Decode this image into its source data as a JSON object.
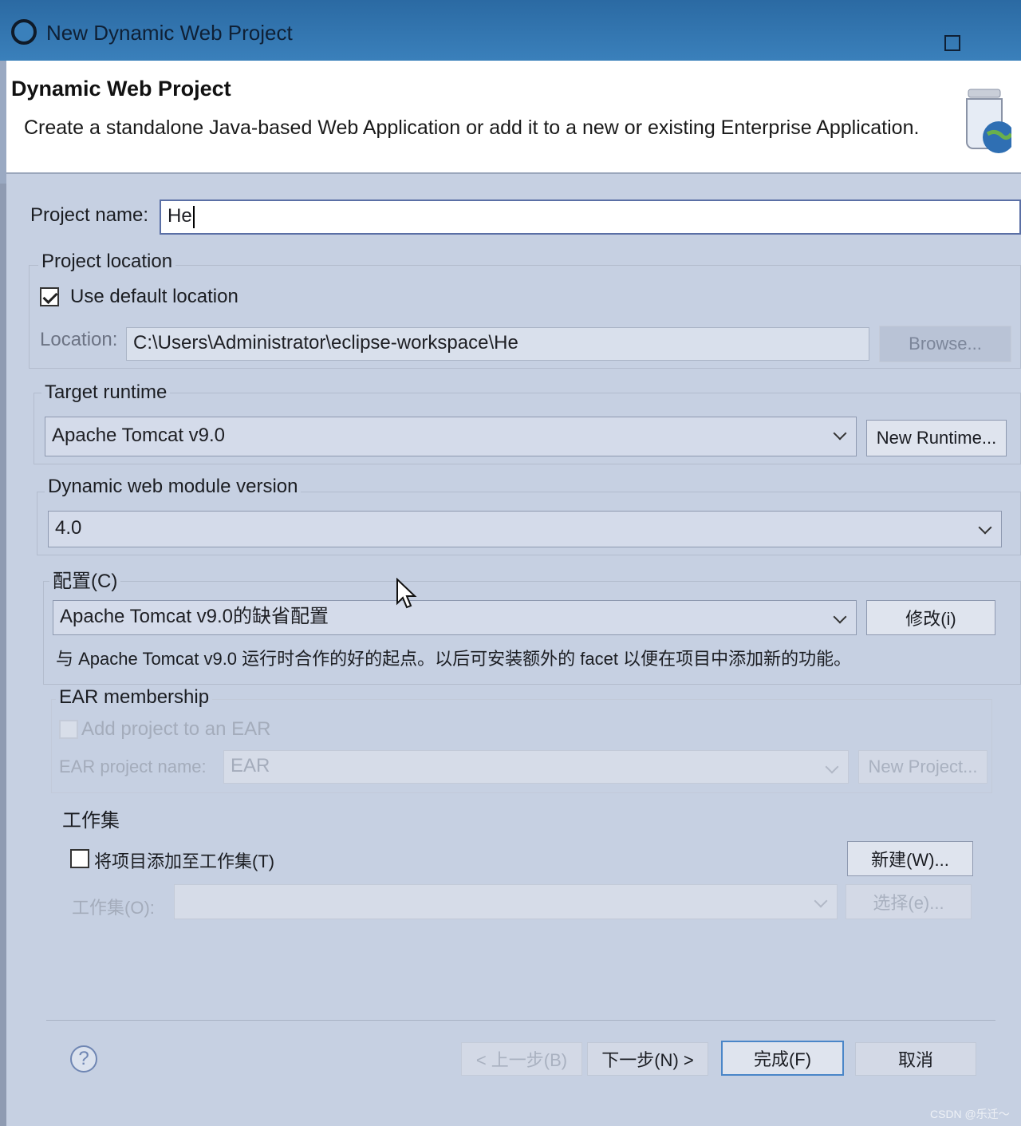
{
  "window": {
    "title": "New Dynamic Web Project"
  },
  "banner": {
    "heading": "Dynamic Web Project",
    "description": "Create a standalone Java-based Web Application or add it to a new or existing Enterprise Application."
  },
  "project_name": {
    "label": "Project name:",
    "value": "He"
  },
  "project_location": {
    "group_label": "Project location",
    "use_default_label": "Use default location",
    "use_default_checked": true,
    "location_label": "Location:",
    "location_value": "C:\\Users\\Administrator\\eclipse-workspace\\He",
    "browse_label": "Browse..."
  },
  "target_runtime": {
    "group_label": "Target runtime",
    "selected": "Apache Tomcat v9.0",
    "new_runtime_label": "New Runtime..."
  },
  "module_version": {
    "group_label": "Dynamic web module version",
    "selected": "4.0"
  },
  "configuration": {
    "group_label": "配置(C)",
    "selected": "Apache Tomcat v9.0的缺省配置",
    "modify_label": "修改(i)",
    "description": "与 Apache Tomcat v9.0 运行时合作的好的起点。以后可安装额外的 facet 以便在项目中添加新的功能。"
  },
  "ear": {
    "group_label": "EAR membership",
    "add_label": "Add project to an EAR",
    "name_label": "EAR project name:",
    "name_value": "EAR",
    "new_project_label": "New Project..."
  },
  "working_sets": {
    "group_label": "工作集",
    "add_label": "将项目添加至工作集(T)",
    "new_label": "新建(W)...",
    "sets_label": "工作集(O):",
    "select_label": "选择(e)..."
  },
  "footer": {
    "back_label": "< 上一步(B)",
    "next_label": "下一步(N) >",
    "finish_label": "完成(F)",
    "cancel_label": "取消"
  },
  "watermark": "CSDN @乐迁～",
  "colors": {
    "titlebar": "#3a80bb",
    "dialog_bg": "#c6d0e2",
    "focus": "#4a86c8"
  }
}
